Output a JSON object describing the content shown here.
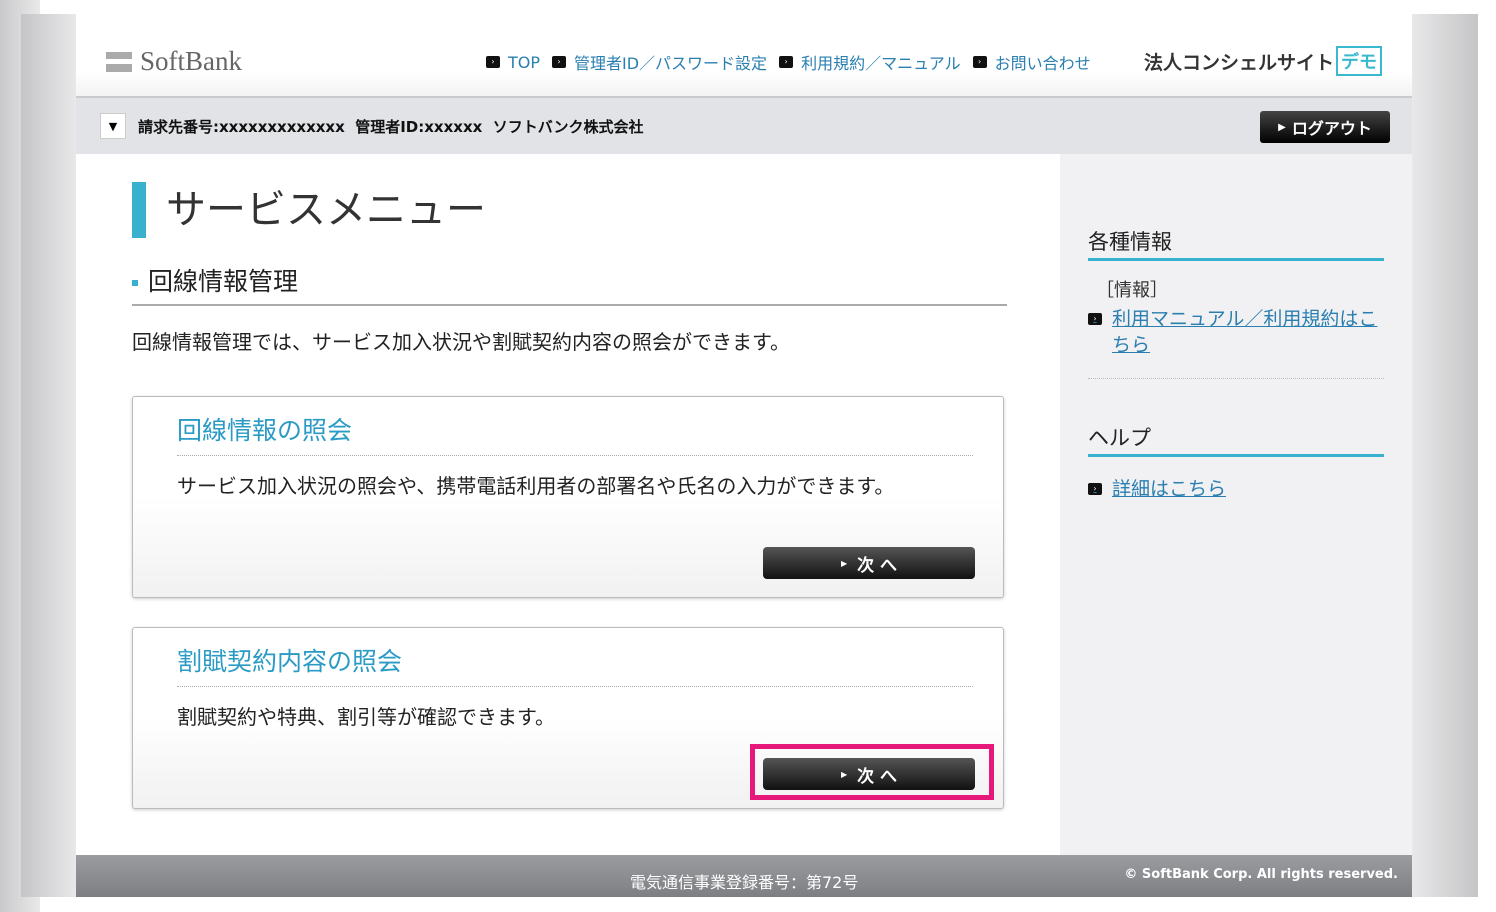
{
  "header": {
    "logo": "SoftBank",
    "nav": [
      "TOP",
      "管理者ID／パスワード設定",
      "利用規約／マニュアル",
      "お問い合わせ"
    ],
    "site_title": "法人コンシェルサイト",
    "demo_badge": "デモ"
  },
  "bar": {
    "info": "請求先番号:xxxxxxxxxxxxx  管理者ID:xxxxxx  ソフトバンク株式会社",
    "logout": "ログアウト"
  },
  "main": {
    "title": "サービスメニュー",
    "section": "回線情報管理",
    "description": "回線情報管理では、サービス加入状況や割賦契約内容の照会ができます。",
    "cards": [
      {
        "title": "回線情報の照会",
        "text": "サービス加入状況の照会や、携帯電話利用者の部署名や氏名の入力ができます。",
        "button": "次 へ"
      },
      {
        "title": "割賦契約内容の照会",
        "text": "割賦契約や特典、割引等が確認できます。",
        "button": "次 へ"
      }
    ]
  },
  "sidebar": {
    "info_heading": "各種情報",
    "info_label": "［情報］",
    "info_link": "利用マニュアル／利用規約はこちら",
    "help_heading": "ヘルプ",
    "help_link": "詳細はこちら"
  },
  "footer": {
    "registration": "電気通信事業登録番号：第72号",
    "copyright": "© SoftBank Corp. All rights reserved."
  },
  "colors": {
    "accent": "#38b1cf",
    "link": "#2a7fb0",
    "highlight": "#e6197a"
  }
}
